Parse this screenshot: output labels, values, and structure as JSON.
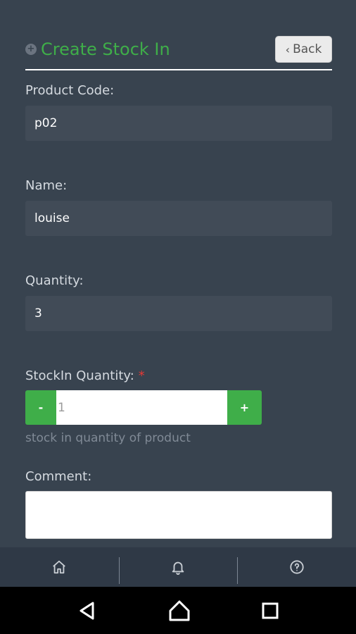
{
  "header": {
    "title": "Create Stock In",
    "back_label": "Back"
  },
  "form": {
    "product_code": {
      "label": "Product Code:",
      "value": "p02"
    },
    "name": {
      "label": "Name:",
      "value": "louise"
    },
    "quantity": {
      "label": "Quantity:",
      "value": "3"
    },
    "stockin_quantity": {
      "label": "StockIn Quantity:",
      "required_mark": "*",
      "minus": "-",
      "plus": "+",
      "value": "1",
      "help": "stock in quantity of product"
    },
    "comment": {
      "label": "Comment:",
      "value": ""
    }
  },
  "tabbar": {
    "items": [
      {
        "icon": "home-icon"
      },
      {
        "icon": "bell-icon"
      },
      {
        "icon": "help-icon"
      }
    ]
  },
  "system_nav": {
    "items": [
      "back-triangle-icon",
      "home-circle-icon",
      "recents-square-icon"
    ]
  },
  "colors": {
    "background": "#38434f",
    "accent": "#3fae49",
    "field": "#414b57",
    "required": "#e53935"
  }
}
